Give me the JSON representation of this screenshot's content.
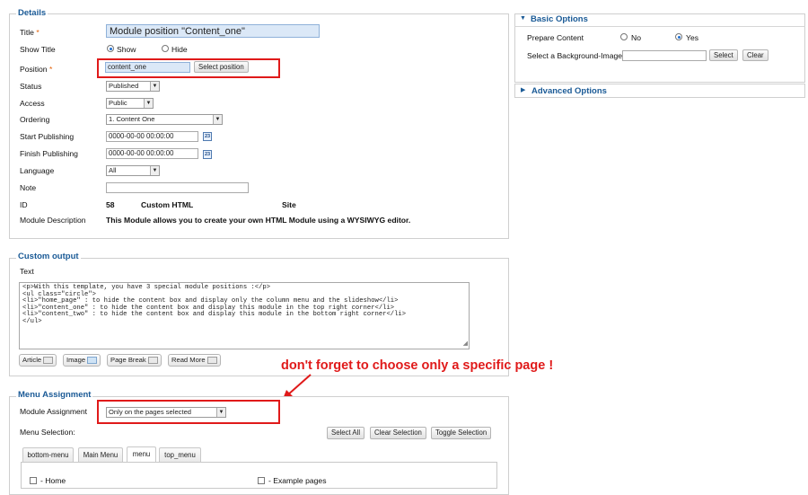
{
  "details": {
    "legend": "Details",
    "title_label": "Title",
    "required_mark": "*",
    "title_value": "Module position \"Content_one\"",
    "show_title_label": "Show Title",
    "show_label": "Show",
    "hide_label": "Hide",
    "position_label": "Position",
    "position_value": "content_one",
    "select_position_button": "Select position",
    "status_label": "Status",
    "status_value": "Published",
    "access_label": "Access",
    "access_value": "Public",
    "ordering_label": "Ordering",
    "ordering_value": "1. Content One",
    "start_publishing_label": "Start Publishing",
    "start_publishing_value": "0000-00-00 00:00:00",
    "finish_publishing_label": "Finish Publishing",
    "finish_publishing_value": "0000-00-00 00:00:00",
    "calendar_label": "23",
    "language_label": "Language",
    "language_value": "All",
    "note_label": "Note",
    "note_value": "",
    "id_label": "ID",
    "id_value": "58",
    "module_type": "Custom HTML",
    "client": "Site",
    "module_description_label": "Module Description",
    "module_description": "This Module allows you to create your own HTML Module using a WYSIWYG editor."
  },
  "custom_output": {
    "legend": "Custom output",
    "text_label": "Text",
    "lines": [
      "<p>With this template, you have 3 special module positions :</p>",
      "<ul class=\"circle\">",
      "<li>\"home_page\" : to hide the content box and display only the column menu and the slideshow</li>",
      "<li>\"content_one\" : to hide the content box and display this module in the top right corner</li>",
      "<li>\"content_two\" : to hide the content box and display this module in the bottom right corner</li>",
      "</ul>"
    ],
    "buttons": [
      "Article",
      "Image",
      "Page Break",
      "Read More"
    ]
  },
  "annotation": "don't forget to choose only a specific page !",
  "menu_assignment": {
    "legend": "Menu Assignment",
    "module_assignment_label": "Module Assignment",
    "module_assignment_value": "Only on the pages selected",
    "menu_selection_label": "Menu Selection:",
    "select_all": "Select All",
    "clear_selection": "Clear Selection",
    "toggle_selection": "Toggle Selection",
    "tabs": [
      "bottom-menu",
      "Main Menu",
      "menu",
      "top_menu"
    ],
    "active_tab": "menu",
    "items": [
      "- Home",
      "- Example pages"
    ]
  },
  "basic_options": {
    "title": "Basic Options",
    "prepare_content_label": "Prepare Content",
    "no_label": "No",
    "yes_label": "Yes",
    "background_image_label": "Select a Background-Image",
    "background_image_value": "",
    "select_button": "Select",
    "clear_button": "Clear"
  },
  "advanced_options": {
    "title": "Advanced Options"
  },
  "colors": {
    "legend": "#1a5a96",
    "highlight": "#e01a1a",
    "required": "#e35d00"
  }
}
